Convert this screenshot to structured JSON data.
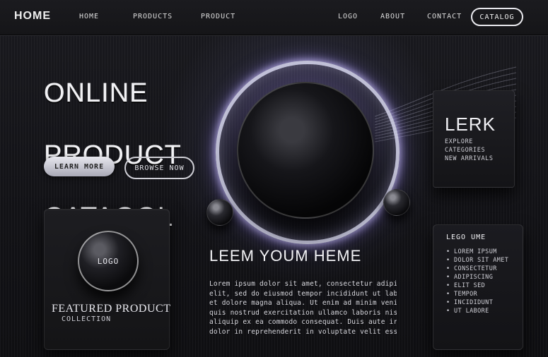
{
  "header": {
    "brand": "HOME",
    "nav_links": [
      "HOME",
      "PRODUCTS",
      "PRODUCT",
      "LOGO",
      "ABOUT",
      "CONTACT"
    ],
    "cta_label": "CATALOG"
  },
  "hero": {
    "title_lines": [
      "ONLINE",
      "PRODUCT",
      "CATAGOL"
    ],
    "primary_button": "LEARN MORE",
    "secondary_button": "BROWSE NOW"
  },
  "featured_card": {
    "orb_label": "LOGO",
    "title": "FEATURED PRODUCT",
    "subtitle": "COLLECTION"
  },
  "main": {
    "title": "LEEM YOUM HEME",
    "paragraph_lines": [
      "Lorem ipsum dolor sit amet, consectetur adipiscing",
      "elit, sed do eiusmod tempor incididunt ut labore",
      "et dolore magna aliqua. Ut enim ad minim veniam,",
      "quis nostrud exercitation ullamco laboris nisi ut",
      "aliquip ex ea commodo consequat. Duis aute irure",
      "dolor in reprehenderit in voluptate velit esse."
    ]
  },
  "right_cards": [
    {
      "title": "LERK",
      "meta_lines": [
        "EXPLORE",
        "CATEGORIES",
        "NEW ARRIVALS"
      ]
    },
    {
      "title": "LEGO UME",
      "list_lines": [
        "• LOREM IPSUM",
        "• DOLOR SIT AMET",
        "• CONSECTETUR",
        "• ADIPISCING",
        "• ELIT SED",
        "• TEMPOR",
        "• INCIDIDUNT",
        "• UT LABORE"
      ]
    }
  ],
  "colors": {
    "background": "#0f0f12",
    "accent_glow": "#c8c1ff",
    "text": "#f2f2f5"
  }
}
